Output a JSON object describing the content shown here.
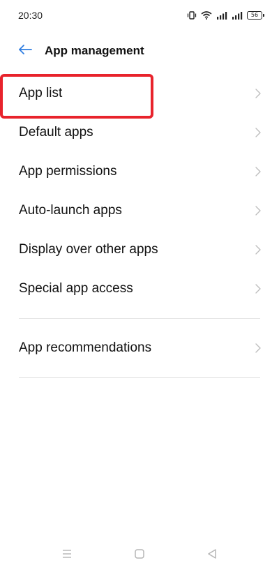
{
  "status_bar": {
    "time": "20:30",
    "battery_level": "56"
  },
  "header": {
    "title": "App management"
  },
  "menu": {
    "items": [
      {
        "label": "App list"
      },
      {
        "label": "Default apps"
      },
      {
        "label": "App permissions"
      },
      {
        "label": "Auto-launch apps"
      },
      {
        "label": "Display over other apps"
      },
      {
        "label": "Special app access"
      },
      {
        "label": "App recommendations"
      }
    ]
  },
  "icons": {
    "back": "arrow-left-icon",
    "chevron": "chevron-right-icon",
    "nav_menu": "menu-icon",
    "nav_home": "square-icon",
    "nav_back": "triangle-back-icon"
  },
  "colors": {
    "accent": "#2f7de1",
    "highlight": "#e8232c",
    "text": "#111111",
    "chevron": "#bdbdbd",
    "divider": "#e3e3e3"
  }
}
